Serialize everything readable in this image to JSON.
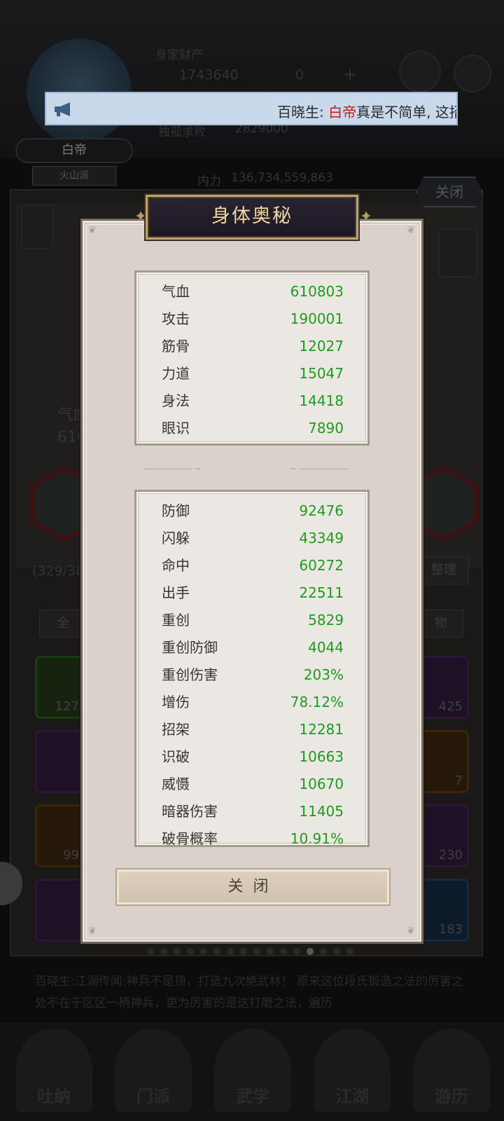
{
  "player": {
    "name": "白帝",
    "sect": "火山派",
    "power_label": "内力",
    "power_value": "136,734,559,863",
    "wealth_label": "身家财产",
    "gold": "1743640",
    "jade": "0",
    "streak_label": "独孤求败",
    "streak_value": "2829000"
  },
  "marquee": {
    "speaker": "百晓生: ",
    "highlight": "白帝",
    "rest": "真是不简单, 这招天人"
  },
  "modal": {
    "title": "身体奥秘",
    "close_label": "关闭",
    "primary_stats": [
      {
        "label": "气血",
        "value": "610803"
      },
      {
        "label": "攻击",
        "value": "190001"
      },
      {
        "label": "筋骨",
        "value": "12027"
      },
      {
        "label": "力道",
        "value": "15047"
      },
      {
        "label": "身法",
        "value": "14418"
      },
      {
        "label": "眼识",
        "value": "7890"
      }
    ],
    "secondary_stats": [
      {
        "label": "防御",
        "value": "92476"
      },
      {
        "label": "闪躲",
        "value": "43349"
      },
      {
        "label": "命中",
        "value": "60272"
      },
      {
        "label": "出手",
        "value": "22511"
      },
      {
        "label": "重创",
        "value": "5829"
      },
      {
        "label": "重创防御",
        "value": "4044"
      },
      {
        "label": "重创伤害",
        "value": "203%"
      },
      {
        "label": "增伤",
        "value": "78.12%"
      },
      {
        "label": "招架",
        "value": "12281"
      },
      {
        "label": "识破",
        "value": "10663"
      },
      {
        "label": "威慑",
        "value": "10670"
      },
      {
        "label": "暗器伤害",
        "value": "11405"
      },
      {
        "label": "破骨概率",
        "value": "10.91%"
      }
    ]
  },
  "background": {
    "close_label": "关闭",
    "tab_all": "全",
    "tab_items": "物",
    "sort_label": "整理",
    "inventory_count": "(329/38",
    "hp_label": "气血",
    "hp_value_partial": "610",
    "slot_counts": {
      "s1": "127",
      "s2": "425",
      "s3": "7",
      "s4": "99",
      "s5": "230",
      "s6": "183"
    },
    "news": "百晓生:江湖传闻:神兵不是顶，打造九次绝武林！ 原来这位段氏锻造之法的厉害之处不在于区区一柄神兵，更为厉害的是这打磨之法，遍历",
    "nav": [
      "吐纳",
      "门派",
      "武学",
      "江湖",
      "游历"
    ]
  }
}
